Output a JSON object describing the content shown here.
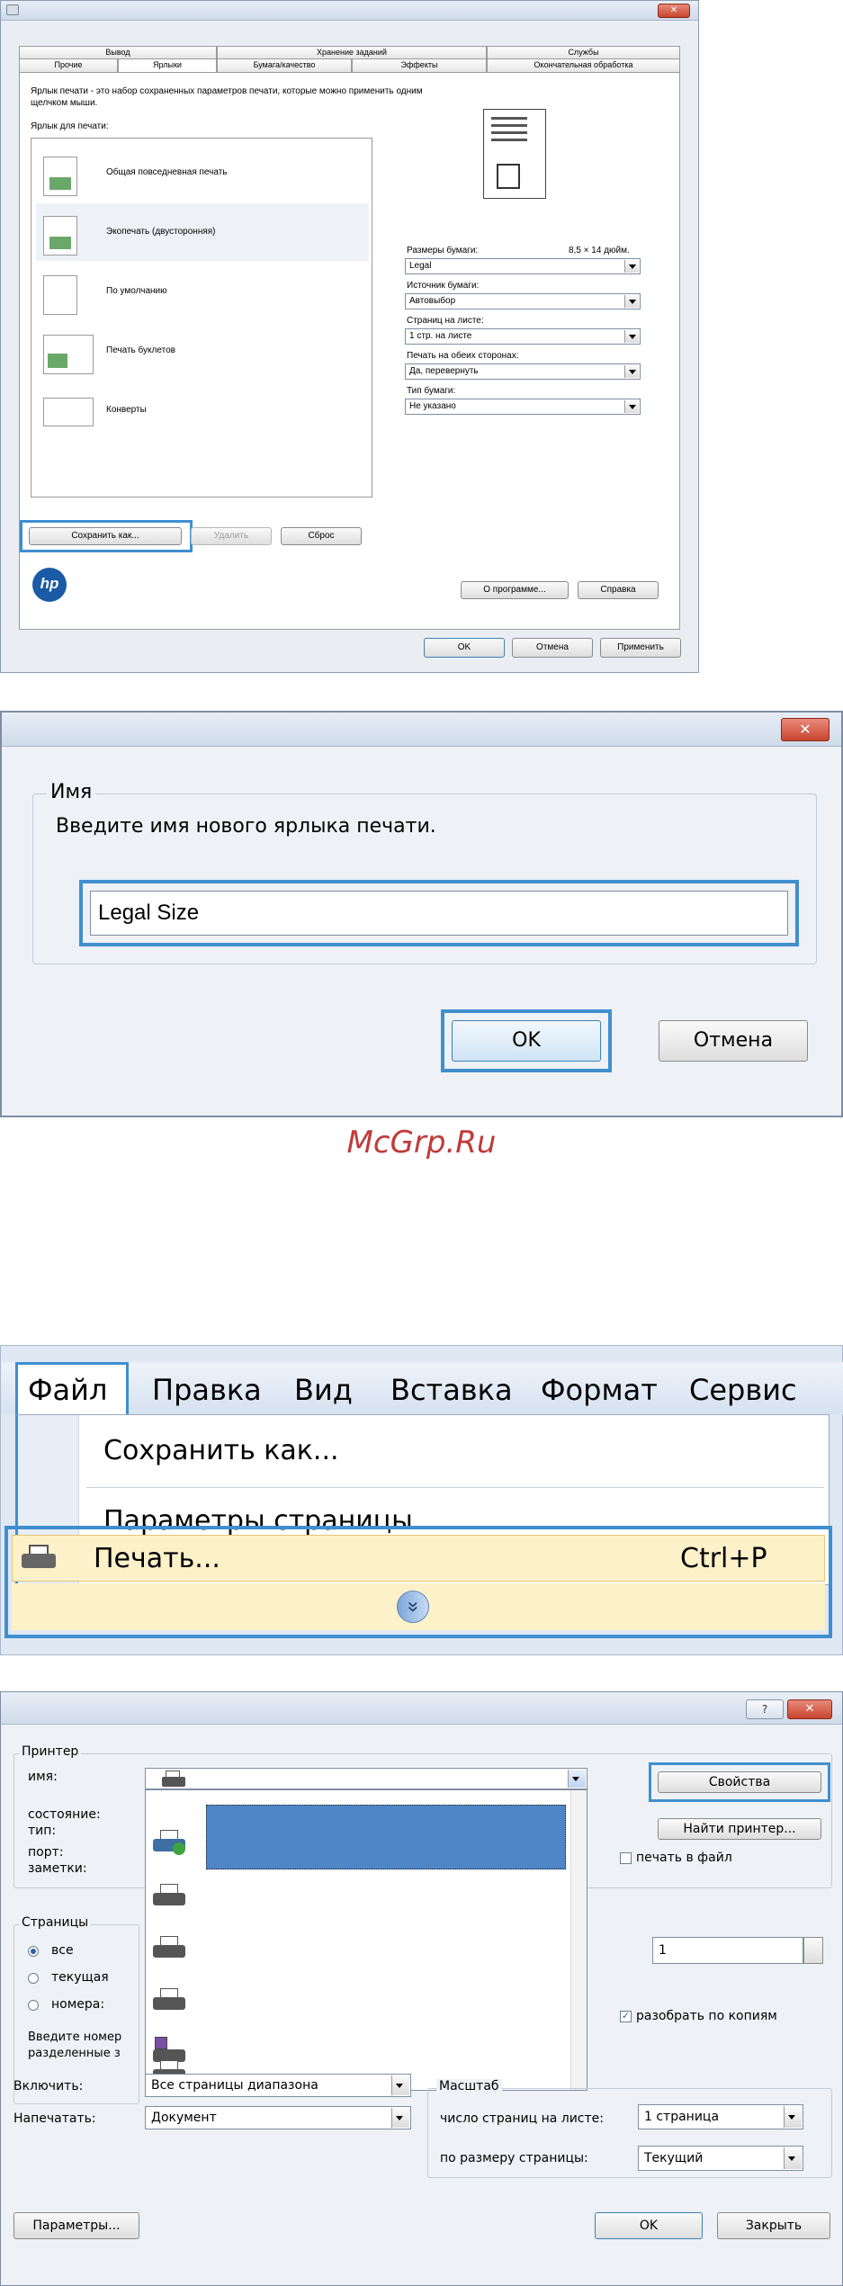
{
  "dialog1": {
    "tabs_top": [
      "Вывод",
      "Хранение заданий",
      "Службы"
    ],
    "tabs_bottom": [
      "Прочие",
      "Ярлыки",
      "Бумага/качество",
      "Эффекты",
      "Окончательная обработка"
    ],
    "description": "Ярлык печати - это набор сохраненных параметров печати, которые можно применить одним щелчком мыши.",
    "list_label": "Ярлык для печати:",
    "presets": [
      "Общая повседневная печать",
      "Экопечать (двусторонняя)",
      "По умолчанию",
      "Печать буклетов",
      "Конверты"
    ],
    "paper_size_label": "Размеры бумаги:",
    "paper_size_dim": "8,5 × 14 дюйм.",
    "paper_size_value": "Legal",
    "source_label": "Источник бумаги:",
    "source_value": "Автовыбор",
    "pages_label": "Страниц на листе:",
    "pages_value": "1 стр. на листе",
    "duplex_label": "Печать на обеих сторонах:",
    "duplex_value": "Да, перевернуть",
    "type_label": "Тип бумаги:",
    "type_value": "Не указано",
    "btn_save_as": "Сохранить как...",
    "btn_delete": "Удалить",
    "btn_reset": "Сброс",
    "btn_about": "О программе...",
    "btn_help": "Справка",
    "btn_ok": "OK",
    "btn_cancel": "Отмена",
    "btn_apply": "Применить",
    "logo_text": "hp",
    "close_glyph": "✕"
  },
  "dialog2": {
    "group_label": "Имя",
    "prompt": "Введите имя нового ярлыка печати.",
    "input_value": "Legal Size",
    "btn_ok": "OK",
    "btn_cancel": "Отмена",
    "close_glyph": "✕"
  },
  "watermark": "McGrp.Ru",
  "menu": {
    "bar_items": [
      "Файл",
      "Правка",
      "Вид",
      "Вставка",
      "Формат",
      "Сервис"
    ],
    "items": [
      "Сохранить как...",
      "Параметры страницы...",
      "Печать..."
    ],
    "print_shortcut": "Ctrl+P",
    "expand_glyph": "»"
  },
  "print_dialog": {
    "help_glyph": "?",
    "close_glyph": "✕",
    "printer_group": "Принтер",
    "name_label": "имя:",
    "status_label": "состояние:",
    "type_label": "тип:",
    "port_label": "порт:",
    "notes_label": "заметки:",
    "btn_properties": "Свойства",
    "btn_find": "Найти принтер...",
    "print_to_file": "печать в файл",
    "pages_group": "Страницы",
    "radio_all": "все",
    "radio_current": "текущая",
    "radio_numbers": "номера:",
    "pages_hint_1": "Введите номер",
    "pages_hint_2": "разделенные з",
    "copies_value": "1",
    "collate": "разобрать по копиям",
    "include_label": "Включить:",
    "include_value": "Все страницы диапазона",
    "print_what_label": "Напечатать:",
    "print_what_value": "Документ",
    "scale_group": "Масштаб",
    "pps_label": "число страниц на листе:",
    "pps_value": "1 страница",
    "fit_label": "по размеру страницы:",
    "fit_value": "Текущий",
    "btn_options": "Параметры...",
    "btn_ok": "OK",
    "btn_close": "Закрыть"
  }
}
